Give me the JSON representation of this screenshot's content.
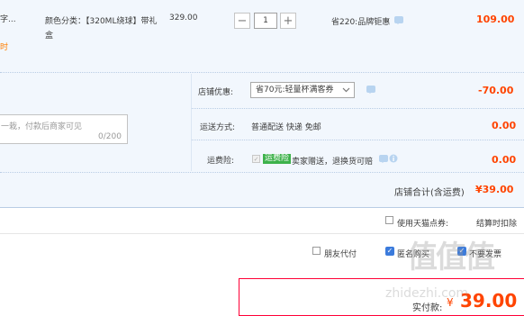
{
  "item": {
    "title_fragment": "字...",
    "orange_fragment": "时",
    "sku_prefix": "颜色分类：【320ML绕球】带礼",
    "sku_suffix": "盒",
    "unit_price": "329.00",
    "quantity": "1",
    "minus": "−",
    "plus": "+",
    "discount": "省220:品牌钜惠",
    "subtotal": "109.00"
  },
  "shop": {
    "coupon_label": "店铺优惠:",
    "coupon_value": "省70元:轻量杯满客券",
    "coupon_amount": "-70.00",
    "message_placeholder": "一栽，付款后商家可见",
    "message_counter": "0/200",
    "shipping_label": "运送方式:",
    "shipping_value": "普通配送 快递 免邮",
    "shipping_amount": "0.00",
    "insurance_label": "运费险:",
    "insurance_badge": "运费险",
    "insurance_value": "卖家赠送，退换货可赔",
    "insurance_amount": "0.00",
    "total_label": "店铺合计(含运费)",
    "total_amount": "¥39.00"
  },
  "points": {
    "label": "使用天猫点券:",
    "note": "结算时扣除"
  },
  "options": {
    "friend_pay": "朋友代付",
    "anonymous": "匿名购买",
    "other": "不要发票"
  },
  "payment": {
    "label": "实付款:",
    "currency": "¥",
    "amount": "39.00"
  },
  "watermark": {
    "logo": "值值值",
    "url": "zhidezhi.com"
  },
  "colors": {
    "price_red": "#ff4400",
    "band_blue": "#f2f7fd",
    "checkbox_blue": "#3b7bdc",
    "insurance_green": "#3db24b"
  }
}
